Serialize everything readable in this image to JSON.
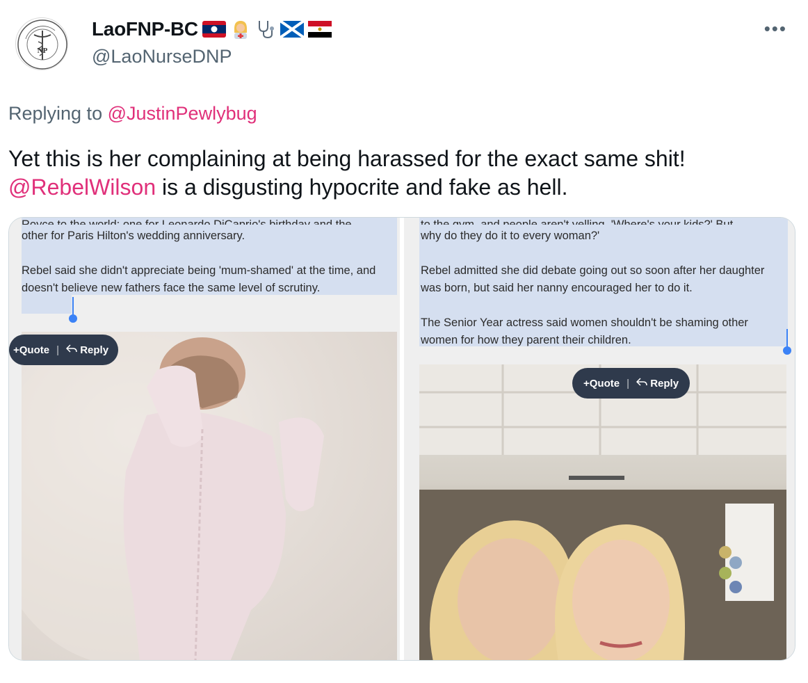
{
  "author": {
    "display_name": "LaoFNP-BC",
    "handle": "@LaoNurseDNP",
    "avatar_text": "Nurse Practitioner",
    "avatar_monogram": "NP",
    "emoji_icons": [
      "laos-flag-icon",
      "woman-health-worker-icon",
      "stethoscope-icon",
      "scotland-flag-icon",
      "egypt-flag-icon"
    ]
  },
  "more_label": "•••",
  "reply": {
    "prefix": "Replying to",
    "to": "@JustinPewlybug"
  },
  "tweet": {
    "line1": "Yet this is her complaining at being harassed for the exact same shit!",
    "mention": "@RebelWilson",
    "line2_rest": " is a disgusting hypocrite and fake as hell."
  },
  "media": {
    "left": {
      "cut_line": "Royce to the world: one for Leonardo DiCaprio's birthday and the",
      "p1": "other for Paris Hilton's wedding anniversary.",
      "p2": "Rebel said she didn't appreciate being 'mum-shamed' at the time, and doesn't believe new fathers face the same level of scrutiny.",
      "quote_label": "Quote",
      "reply_label": "Reply",
      "quote_prefix": "+"
    },
    "right": {
      "cut_line": "to the gym, and people aren't yelling, 'Where's your kids?' But",
      "p1": "why do they do it to every woman?'",
      "p2": "Rebel admitted she did debate going out so soon after her daughter was born, but said her nanny encouraged her to do it.",
      "p3": "The Senior Year actress said women shouldn't be shaming other women for how they parent their children.",
      "quote_label": "Quote",
      "reply_label": "Reply",
      "quote_prefix": "+"
    }
  },
  "colors": {
    "mention": "#e0307a",
    "secondary_text": "#536471",
    "highlight": "#d5dff0",
    "pill": "#2f3a4c",
    "caret": "#3b82f6"
  }
}
